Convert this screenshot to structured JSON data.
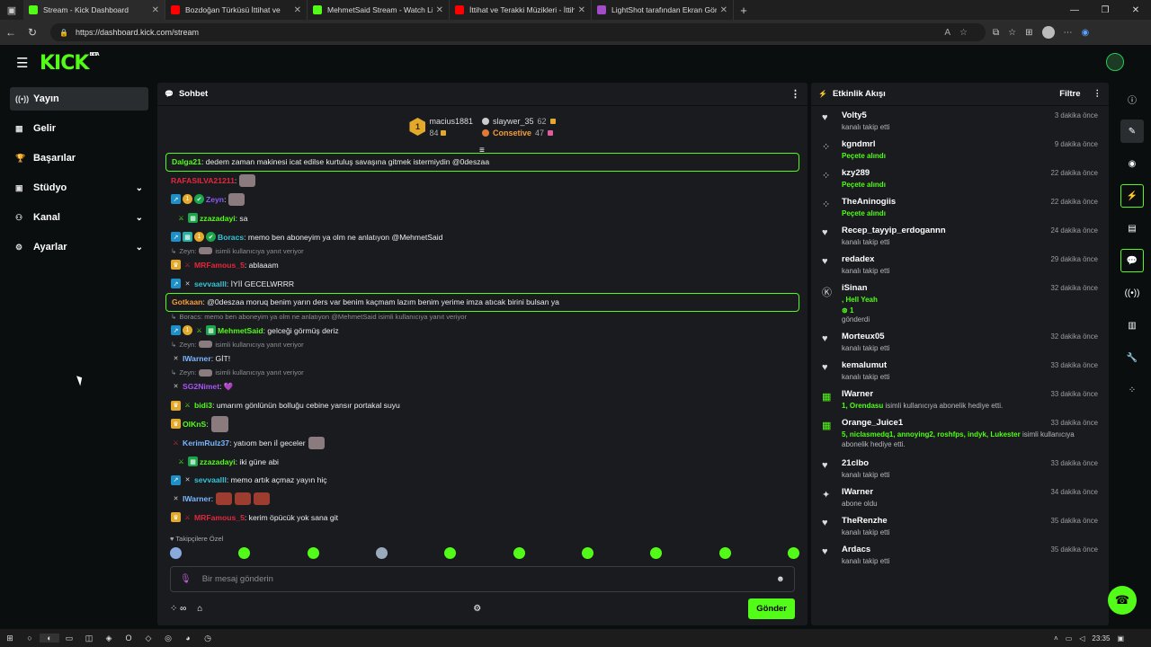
{
  "browser": {
    "tabs": [
      {
        "title": "Stream - Kick Dashboard",
        "color": "#53fc18"
      },
      {
        "title": "Bozdoğan Türküsü İttihat ve",
        "color": "#ff0000"
      },
      {
        "title": "MehmetSaid Stream - Watch Live",
        "color": "#53fc18"
      },
      {
        "title": "İttihat ve Terakki Müzikleri - İttihat",
        "color": "#ff0000"
      },
      {
        "title": "LightShot tarafından Ekran Görünt",
        "color": "#a24cc7"
      }
    ],
    "url": "https://dashboard.kick.com/stream"
  },
  "app": {
    "logo": "KICK",
    "beta": "BETA"
  },
  "sidebar": {
    "items": [
      {
        "label": "Yayın",
        "icon": "broadcast-icon"
      },
      {
        "label": "Gelir",
        "icon": "revenue-icon"
      },
      {
        "label": "Başarılar",
        "icon": "trophy-icon"
      },
      {
        "label": "Stüdyo",
        "icon": "studio-icon"
      },
      {
        "label": "Kanal",
        "icon": "channel-icon"
      },
      {
        "label": "Ayarlar",
        "icon": "gear-icon"
      }
    ]
  },
  "chat": {
    "title": "Sohbet",
    "leaderboard": {
      "first": {
        "name": "macius1881",
        "count": "84"
      },
      "second": {
        "name": "slaywer_35",
        "count": "62"
      },
      "third": {
        "name": "Consetive",
        "count": "47"
      }
    },
    "messages": [
      {
        "user": "Dalga21",
        "text": ": dedem zaman makinesi icat edilse kurtuluş savaşına gitmek istermiydin @0deszaa"
      },
      {
        "user": "RAFASILVA21211",
        "text": ":"
      },
      {
        "user": "Zeyn",
        "text": ":"
      },
      {
        "user": "zzazadayi",
        "text": ": sa"
      },
      {
        "user": "Boracs",
        "text": ": memo ben aboneyim ya olm ne anlatıyon @MehmetSaid"
      },
      {
        "reply": "Zeyn:",
        "reply_tail": "isimli kullanıcıya yanıt veriyor"
      },
      {
        "user": "MRFamous_5",
        "text": ": ablaaam"
      },
      {
        "user": "sevvaalll",
        "text": ": İYİİ GECELWRRR"
      },
      {
        "user": "Gotkaan",
        "text": ": @0deszaa moruq benim yarın ders var benim kaçmam lazım benim yerime imza atıcak birini bulsan ya"
      },
      {
        "reply": "Boracs: memo ben aboneyim ya olm ne anlatıyon @MehmetSaid isimli kullanıcıya yanıt veriyor",
        "reply_tail": ""
      },
      {
        "user": "MehmetSaid",
        "text": ": gelceği görmüş deriz"
      },
      {
        "reply": "Zeyn:",
        "reply_tail": "isimli kullanıcıya yanıt veriyor"
      },
      {
        "user": "IWarner",
        "text": ": GİT!"
      },
      {
        "reply": "Zeyn:",
        "reply_tail": "isimli kullanıcıya yanıt veriyor"
      },
      {
        "user": "SG2Nimet",
        "text": ": 💜"
      },
      {
        "user": "bidi3",
        "text": ": umarım gönlünün bolluğu cebine yansır portakal suyu"
      },
      {
        "user": "OIKnS",
        "text": ":"
      },
      {
        "user": "KerimRulz37",
        "text": ": yatıom ben iİ geceler"
      },
      {
        "user": "zzazadayi",
        "text": ": iki güne abi"
      },
      {
        "user": "sevvaalll",
        "text": ": memo artık açmaz yayın hiç"
      },
      {
        "user": "IWarner",
        "text": ":"
      },
      {
        "user": "MRFamous_5",
        "text": ": kerim öpücük yok sana git"
      }
    ],
    "emote_section": "Takipçilere Özel",
    "input_placeholder": "Bir mesaj gönderin",
    "send_label": "Gönder"
  },
  "activity": {
    "title": "Etkinlik Akışı",
    "filter": "Filtre",
    "items": [
      {
        "name": "Volty5",
        "desc": "kanalı takip etti",
        "time": "3 dakika önce",
        "icon": "heart-icon"
      },
      {
        "name": "kgndmrl",
        "desc": "Peçete alındı",
        "time": "9 dakika önce",
        "icon": "points-icon",
        "green": true
      },
      {
        "name": "kzy289",
        "desc": "Peçete alındı",
        "time": "22 dakika önce",
        "icon": "points-icon",
        "green": true
      },
      {
        "name": "TheAninogiis",
        "desc": "Peçete alındı",
        "time": "22 dakika önce",
        "icon": "points-icon",
        "green": true
      },
      {
        "name": "Recep_tayyip_erdogannn",
        "desc": "kanalı takip etti",
        "time": "24 dakika önce",
        "icon": "heart-icon"
      },
      {
        "name": "redadex",
        "desc": "kanalı takip etti",
        "time": "29 dakika önce",
        "icon": "heart-icon"
      },
      {
        "name": "iSinan",
        "desc": ", Hell Yeah",
        "extra": "1",
        "desc2": "gönderdi",
        "time": "32 dakika önce",
        "icon": "kick-icon",
        "green": true
      },
      {
        "name": "Morteux05",
        "desc": "kanalı takip etti",
        "time": "32 dakika önce",
        "icon": "heart-icon"
      },
      {
        "name": "kemalumut",
        "desc": "kanalı takip etti",
        "time": "33 dakika önce",
        "icon": "heart-icon"
      },
      {
        "name": "IWarner",
        "desc": "1, Orendasu",
        "desc_tail": " isimli kullanıcıya abonelik hediye etti.",
        "time": "33 dakika önce",
        "icon": "gift-icon"
      },
      {
        "name": "Orange_Juice1",
        "desc": "5, niclasmedq1, annoying2, roshfps, indyk, Lukester",
        "desc_tail": " isimli kullanıcıya abonelik hediye etti.",
        "time": "33 dakika önce",
        "icon": "gift-icon"
      },
      {
        "name": "21clbo",
        "desc": "kanalı takip etti",
        "time": "33 dakika önce",
        "icon": "heart-icon"
      },
      {
        "name": "IWarner",
        "desc": "abone oldu",
        "time": "34 dakika önce",
        "icon": "star-icon"
      },
      {
        "name": "TheRenzhe",
        "desc": "kanalı takip etti",
        "time": "35 dakika önce",
        "icon": "heart-icon"
      },
      {
        "name": "Ardacs",
        "desc": "kanalı takip etti",
        "time": "35 dakika önce",
        "icon": "heart-icon"
      }
    ]
  },
  "taskbar": {
    "time": "23:35"
  },
  "colors": {
    "accent": "#53fc18",
    "panel": "#191b1f",
    "bg": "#0b0e0f"
  }
}
